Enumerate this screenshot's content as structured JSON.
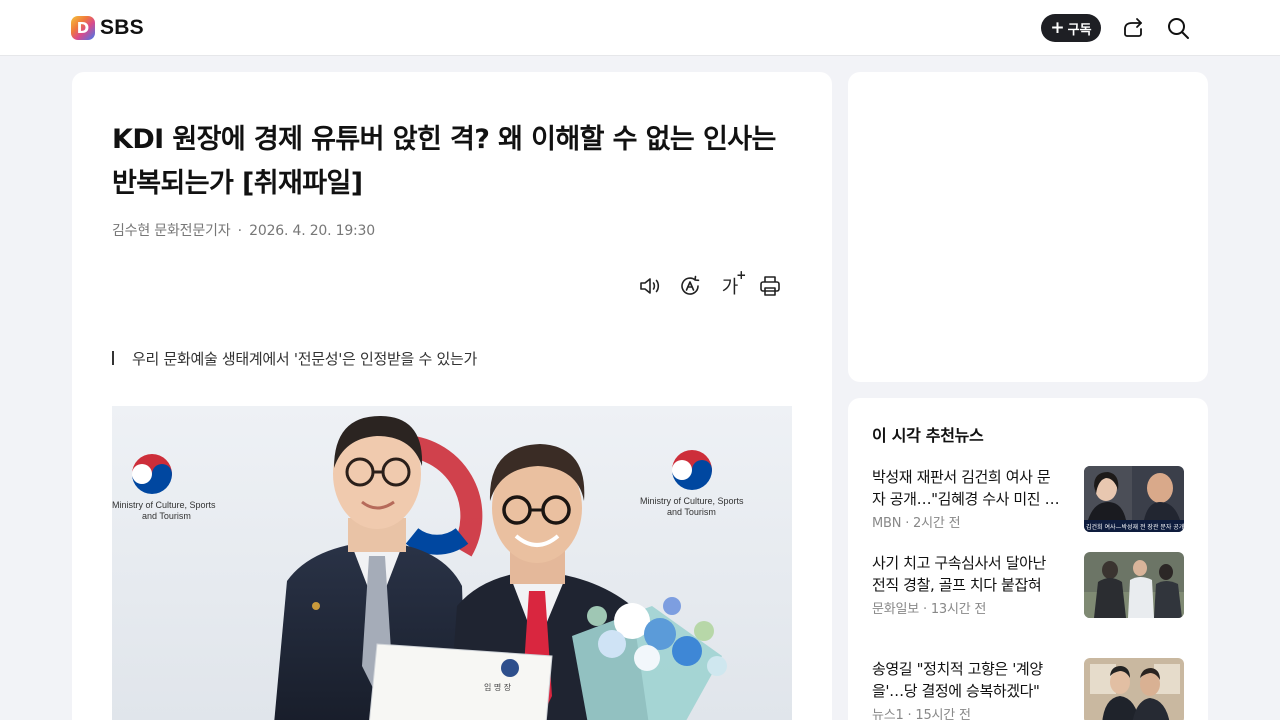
{
  "header": {
    "logo_letter": "D",
    "logo_text": "SBS",
    "subscribe_label": "구독",
    "share_icon": "share-icon",
    "search_icon": "search-icon"
  },
  "article": {
    "headline": "KDI 원장에 경제 유튜버 앉힌 격? 왜 이해할 수 없는 인사는 반복되는가 [취재파일]",
    "author": "김수현 문화전문기자",
    "separator": "·",
    "datetime": "2026. 4. 20. 19:30",
    "tools": {
      "listen_icon": "speaker-icon",
      "translate_icon": "translate-icon",
      "font_label": "가",
      "font_plus": "+",
      "print_icon": "print-icon"
    },
    "subhead": "우리 문화예술 생태계에서 '전문성'은 인정받을 수 있는가",
    "photo": {
      "logo_text_left": [
        "Ministry of Culture, Sports",
        "and Tourism"
      ],
      "logo_text_right": [
        "Ministry of Culture, Sports",
        "and Tourism"
      ],
      "certificate_title": "임 명 장"
    }
  },
  "sidebar": {
    "recommended_title": "이 시각 추천뉴스",
    "items": [
      {
        "title": "박성재 재판서 김건희 여사 문자 공개…\"김혜경 수사 미진 …",
        "meta": "MBN · 2시간 전"
      },
      {
        "title": "사기 치고 구속심사서 달아난 전직 경찰, 골프 치다 붙잡혀",
        "meta": "문화일보 · 13시간 전"
      },
      {
        "title": "송영길 \"정치적 고향은 '계양을'…당 결정에 승복하겠다\"",
        "meta": "뉴스1 · 15시간 전"
      }
    ],
    "thumb1_caption": "김건희 여사—박성재 전 장관 문자 공개"
  },
  "colors": {
    "page_bg": "#f2f3f7",
    "card_bg": "#ffffff",
    "subscribe_bg": "#1e1f24",
    "meta_text": "#888888"
  }
}
